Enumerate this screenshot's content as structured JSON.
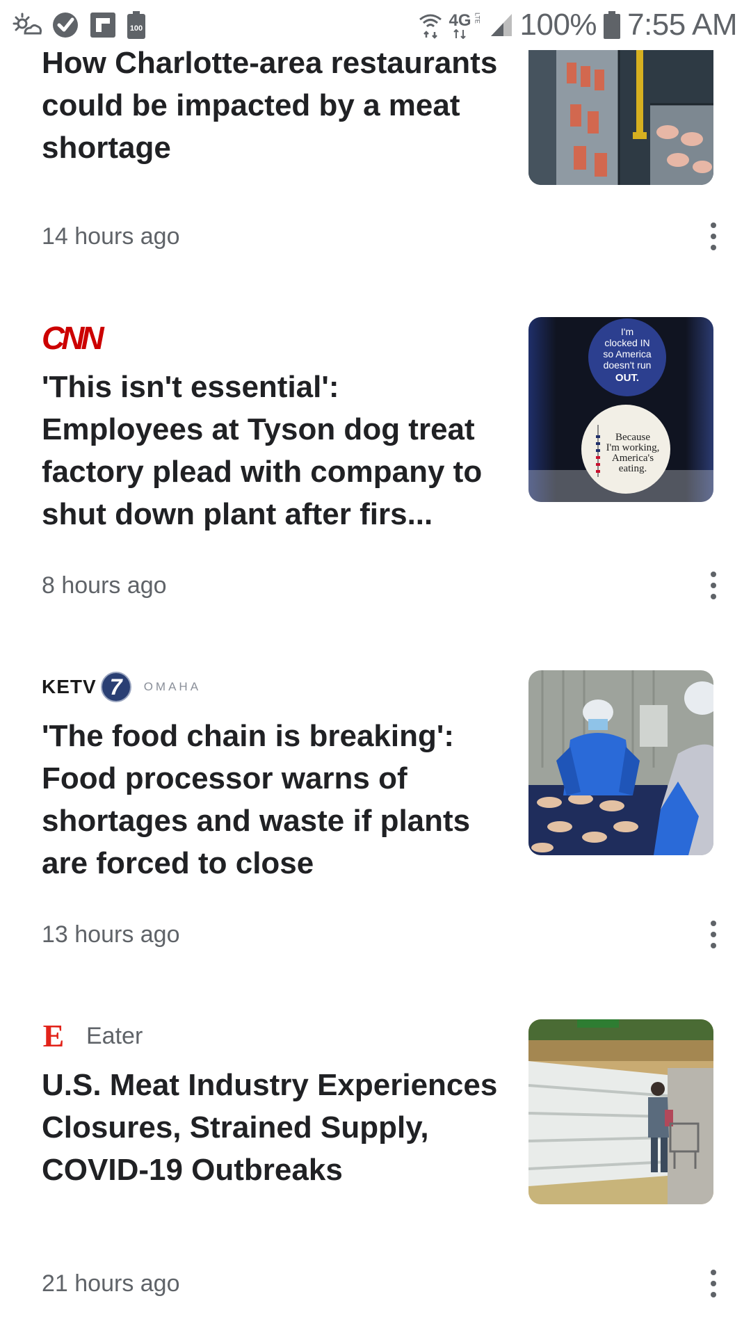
{
  "status_bar": {
    "network_label": "4G",
    "network_sub": "LTE",
    "battery_percent": "100%",
    "time": "7:55 AM",
    "notification_icons": [
      "weather-icon",
      "check-circle-icon",
      "flipboard-icon",
      "battery-saver-icon"
    ],
    "battery_saver_label": "100"
  },
  "articles": [
    {
      "source": "",
      "headline": "How Charlotte-area restaurants could be impacted by a meat shortage",
      "timestamp": "14 hours ago",
      "thumbnail": "meat-processing-conveyor"
    },
    {
      "source": "CNN",
      "headline": "'This isn't essential': Employees at Tyson dog treat factory plead with company to shut down plant after firs...",
      "timestamp": "8 hours ago",
      "thumbnail": "america-eating-stickers",
      "image_text": {
        "sticker_top": [
          "I'm",
          "clocked IN",
          "so America",
          "doesn't run",
          "OUT."
        ],
        "sticker_bottom": [
          "Because",
          "I'm working,",
          "America's",
          "eating."
        ]
      }
    },
    {
      "source": "KETV",
      "source_seven": "7",
      "source_city": "OMAHA",
      "headline": "'The food chain is breaking': Food processor warns of shortages and waste if plants are forced to close",
      "timestamp": "13 hours ago",
      "thumbnail": "food-processing-workers"
    },
    {
      "source": "Eater",
      "source_logo": "E",
      "headline": "U.S. Meat Industry Experiences Closures, Strained Supply, COVID-19 Outbreaks",
      "timestamp": "21 hours ago",
      "thumbnail": "empty-meat-shelves"
    }
  ],
  "colors": {
    "cnn_red": "#cc0000",
    "eater_red": "#e2231a",
    "text_primary": "#202124",
    "text_secondary": "#5f6368"
  }
}
